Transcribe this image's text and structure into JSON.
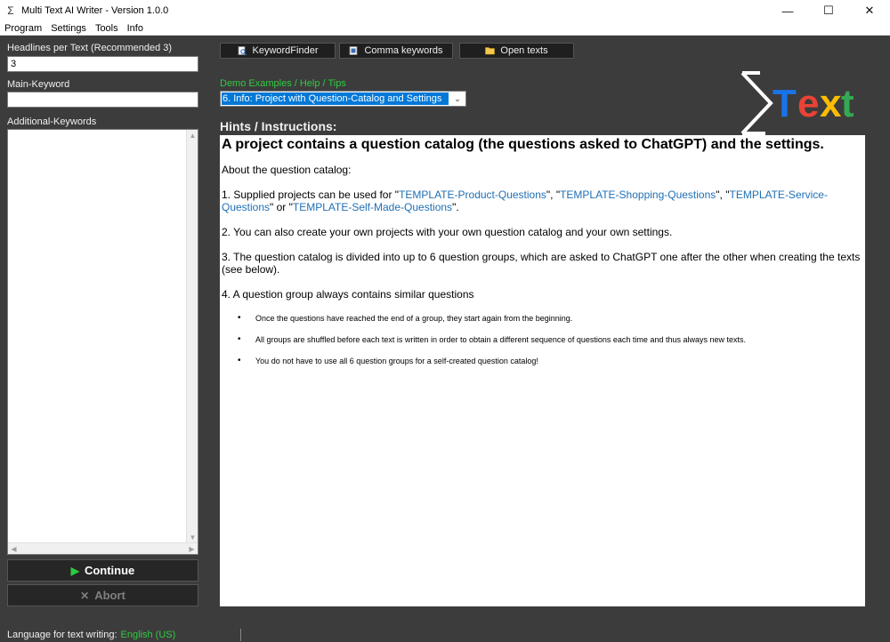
{
  "window": {
    "title": "Multi Text AI Writer - Version 1.0.0"
  },
  "menu": [
    "Program",
    "Settings",
    "Tools",
    "Info"
  ],
  "left": {
    "headlines_label": "Headlines per Text (Recommended 3)",
    "headlines_value": "3",
    "main_keyword_label": "Main-Keyword",
    "main_keyword_value": "",
    "additional_label": "Additional-Keywords",
    "continue_label": "Continue",
    "abort_label": "Abort"
  },
  "toolbar": {
    "keywordfinder": "KeywordFinder",
    "comma_keywords": "Comma keywords",
    "open_texts": "Open texts"
  },
  "demo": {
    "label": "Demo Examples / Help / Tips",
    "selected": "6. Info: Project with Question-Catalog and Settings"
  },
  "hints": {
    "title": "Hints / Instructions:",
    "heading": "A project contains a question catalog (the questions asked to ChatGPT) and the settings.",
    "about": "About the question catalog:",
    "p1_pre": "1. Supplied projects can be used for \"",
    "p1_link1": "TEMPLATE-Product-Questions",
    "p1_mid1": "\", \"",
    "p1_link2": "TEMPLATE-Shopping-Questions",
    "p1_mid2": "\", \"",
    "p1_link3": "TEMPLATE-Service-Questions",
    "p1_mid3": "\" or \"",
    "p1_link4": "TEMPLATE-Self-Made-Questions",
    "p1_post": "\".",
    "p2": "2. You can also create your own projects with your own question catalog and your own settings.",
    "p3": "3. The question catalog is divided into up to 6 question groups, which are asked to ChatGPT one after the other when creating the texts (see below).",
    "p4": "4. A question group always contains similar questions",
    "bullets": [
      "Once the questions have reached the end of a group, they start again from the beginning.",
      "All groups are shuffled before each text is written in order to obtain a different sequence of questions each time and thus always new texts.",
      "You do not have to use all 6 question groups for a self-created question catalog!"
    ]
  },
  "logo": {
    "letters": [
      "T",
      "e",
      "x",
      "t"
    ],
    "colors": [
      "#1a73e8",
      "#ea4335",
      "#fbbc04",
      "#34a853"
    ]
  },
  "status": {
    "label": "Language for text writing:",
    "value": "English (US)"
  }
}
